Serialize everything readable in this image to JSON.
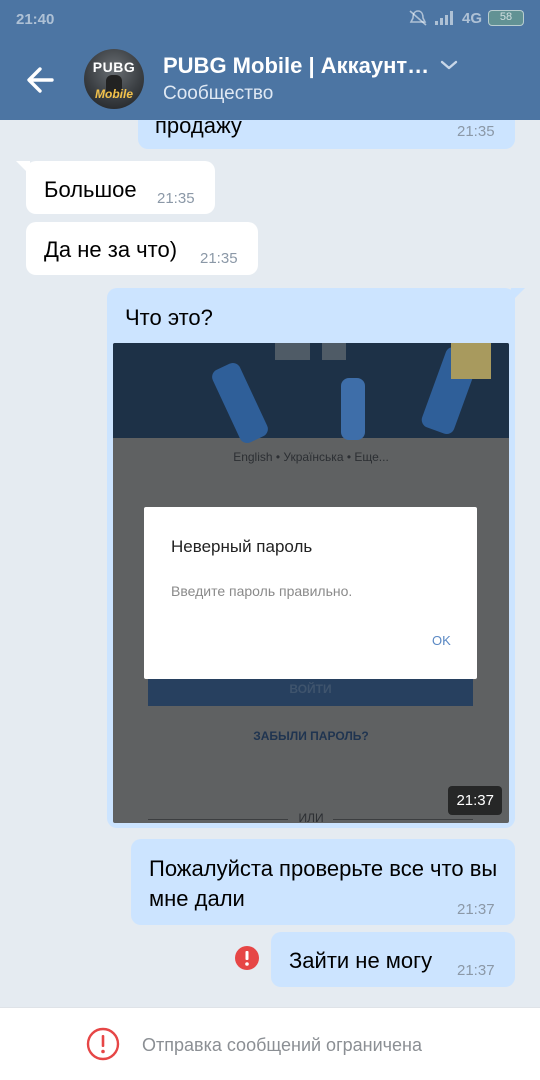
{
  "status_bar": {
    "time": "21:40",
    "network": "4G",
    "battery": "58"
  },
  "header": {
    "title": "PUBG Mobile | Аккаунт…",
    "subtitle": "Сообщество",
    "avatar_line1": "PUBG",
    "avatar_line2": "Mobile"
  },
  "messages": [
    {
      "text": "продажу",
      "time": "21:35"
    },
    {
      "text": "Большое",
      "time": "21:35"
    },
    {
      "text": "Да не за что)",
      "time": "21:35"
    },
    {
      "text": "Что это?",
      "time": "21:37",
      "photo": {
        "languages": "English • Українська • Еще...",
        "dialog_title": "Неверный пароль",
        "dialog_text": "Введите пароль правильно.",
        "dialog_ok": "OK",
        "login_button": "ВОЙТИ",
        "forgot": "ЗАБЫЛИ ПАРОЛЬ?",
        "or": "ИЛИ"
      }
    },
    {
      "text": "Пожалуйста проверьте все что вы мне дали",
      "time": "21:37"
    },
    {
      "text": "Зайти не могу",
      "time": "21:37",
      "error": true
    }
  ],
  "footer": {
    "text": "Отправка сообщений ограничена"
  },
  "colors": {
    "header": "#4c75a3",
    "outgoing": "#cce4ff",
    "incoming": "#ffffff",
    "error": "#e64646"
  }
}
